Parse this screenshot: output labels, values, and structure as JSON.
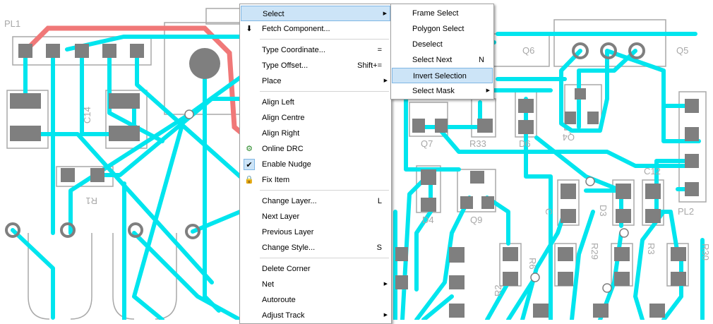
{
  "board": {
    "designators": [
      "PL1",
      "Q6",
      "Q5",
      "C14",
      "R1",
      "D6",
      "Q7",
      "R33",
      "Q4",
      "C12",
      "PL2",
      "D4",
      "Q9",
      "C",
      "D3",
      "R30",
      "R29",
      "R3",
      "R2",
      "R6"
    ]
  },
  "context_menu": {
    "items": [
      {
        "label": "Select",
        "shortcut": "",
        "submenu": true
      },
      {
        "label": "Fetch Component...",
        "shortcut": "",
        "submenu": false
      },
      {
        "label": "Type Coordinate...",
        "shortcut": "=",
        "submenu": false
      },
      {
        "label": "Type Offset...",
        "shortcut": "Shift+=",
        "submenu": false
      },
      {
        "label": "Place",
        "shortcut": "",
        "submenu": true
      },
      {
        "label": "Align Left",
        "shortcut": "",
        "submenu": false
      },
      {
        "label": "Align Centre",
        "shortcut": "",
        "submenu": false
      },
      {
        "label": "Align Right",
        "shortcut": "",
        "submenu": false
      },
      {
        "label": "Online DRC",
        "shortcut": "",
        "submenu": false
      },
      {
        "label": "Enable Nudge",
        "shortcut": "",
        "submenu": false,
        "checked": true
      },
      {
        "label": "Fix Item",
        "shortcut": "",
        "submenu": false
      },
      {
        "label": "Change Layer...",
        "shortcut": "L",
        "submenu": false
      },
      {
        "label": "Next Layer",
        "shortcut": "",
        "submenu": false
      },
      {
        "label": "Previous Layer",
        "shortcut": "",
        "submenu": false
      },
      {
        "label": "Change Style...",
        "shortcut": "S",
        "submenu": false
      },
      {
        "label": "Delete Corner",
        "shortcut": "",
        "submenu": false
      },
      {
        "label": "Net",
        "shortcut": "",
        "submenu": true
      },
      {
        "label": "Autoroute",
        "shortcut": "",
        "submenu": false
      },
      {
        "label": "Adjust Track",
        "shortcut": "",
        "submenu": true
      }
    ]
  },
  "select_submenu": {
    "items": [
      {
        "label": "Frame Select",
        "shortcut": ""
      },
      {
        "label": "Polygon Select",
        "shortcut": ""
      },
      {
        "label": "Deselect",
        "shortcut": ""
      },
      {
        "label": "Select Next",
        "shortcut": "N"
      },
      {
        "label": "Invert Selection",
        "shortcut": ""
      },
      {
        "label": "Select Mask",
        "shortcut": "",
        "submenu": true
      }
    ]
  },
  "icons": {
    "checkmark": "check-icon",
    "lock": "lock-icon",
    "fetch": "fetch-component-icon",
    "drc": "online-drc-icon"
  },
  "colors": {
    "track": "#00e5ee",
    "pad": "#7f7f7f",
    "silk": "#a8a8a8",
    "red_track": "#f07878",
    "highlight": "#cce4f7"
  }
}
